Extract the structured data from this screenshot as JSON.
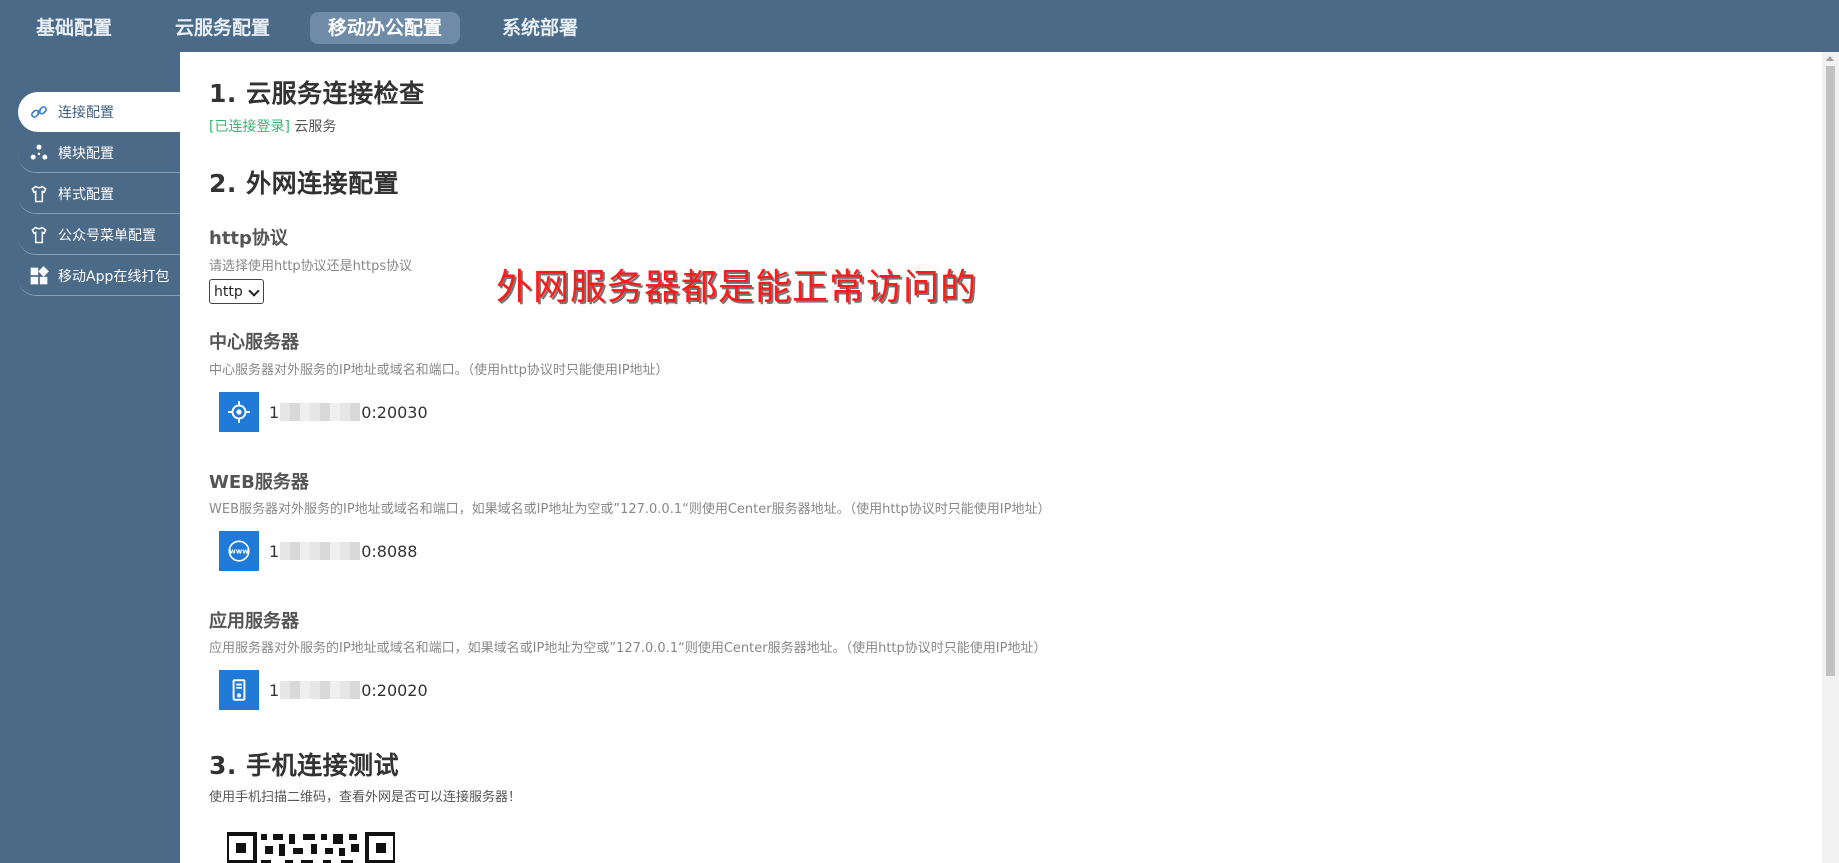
{
  "top_tabs": [
    {
      "label": "基础配置"
    },
    {
      "label": "云服务配置"
    },
    {
      "label": "移动办公配置"
    },
    {
      "label": "系统部署"
    }
  ],
  "sidebar": {
    "items": [
      {
        "label": "连接配置",
        "icon": "link-icon"
      },
      {
        "label": "模块配置",
        "icon": "modules-icon"
      },
      {
        "label": "样式配置",
        "icon": "shirt-icon"
      },
      {
        "label": "公众号菜单配置",
        "icon": "shirt-icon"
      },
      {
        "label": "移动App在线打包",
        "icon": "grid-icon"
      }
    ]
  },
  "section1": {
    "title": "1. 云服务连接检查",
    "status_ok": "[已连接登录]",
    "status_service": "云服务"
  },
  "section2": {
    "title": "2. 外网连接配置",
    "http": {
      "title": "http协议",
      "desc": "请选择使用http协议还是https协议",
      "selected": "http"
    },
    "center": {
      "title": "中心服务器",
      "desc": "中心服务器对外服务的IP地址或域名和端口。（使用http协议时只能使用IP地址）",
      "value_prefix": "1",
      "value_suffix": "0:20030"
    },
    "web": {
      "title": "WEB服务器",
      "desc": "WEB服务器对外服务的IP地址或域名和端口，如果域名或IP地址为空或”127.0.0.1“则使用Center服务器地址。（使用http协议时只能使用IP地址）",
      "value_prefix": "1",
      "value_suffix": "0:8088"
    },
    "app": {
      "title": "应用服务器",
      "desc": "应用服务器对外服务的IP地址或域名和端口，如果域名或IP地址为空或”127.0.0.1“则使用Center服务器地址。（使用http协议时只能使用IP地址）",
      "value_prefix": "1",
      "value_suffix": "0:20020"
    }
  },
  "section3": {
    "title": "3. 手机连接测试",
    "desc": "使用手机扫描二维码，查看外网是否可以连接服务器！"
  },
  "overlay_annotation": "外网服务器都是能正常访问的",
  "colors": {
    "topbar": "#4b6a88",
    "active_tab": "#6f8ba7",
    "server_icon": "#1f7ad8",
    "status_ok": "#3cb371",
    "annotation": "#ff1a1a"
  }
}
